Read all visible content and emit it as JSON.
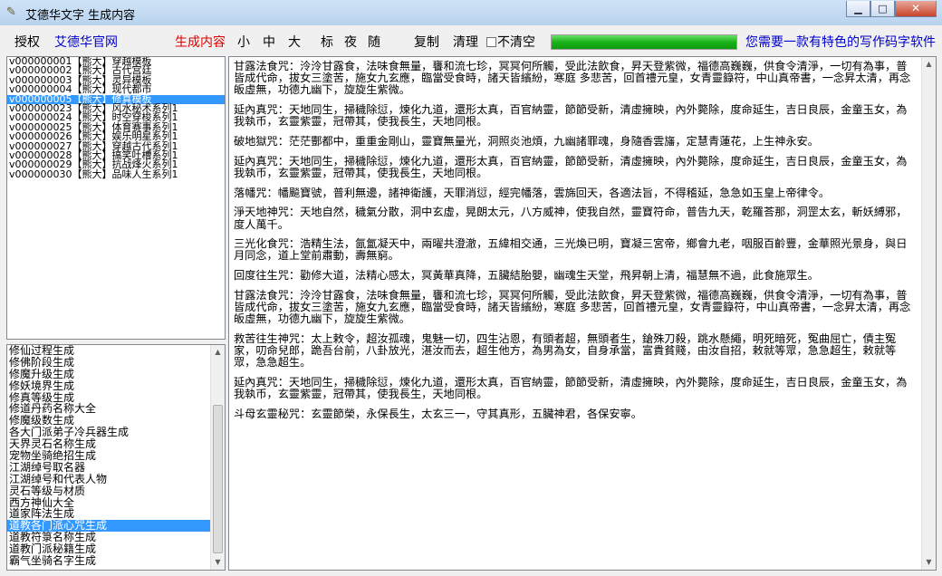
{
  "window": {
    "title": "艾德华文字 生成内容",
    "app_icon": "feather-icon",
    "buttons": {
      "minimize": "▁",
      "maximize": "□",
      "close": "✕"
    }
  },
  "toolbar": {
    "authorize": "授权",
    "official_site": "艾德华官网",
    "generate": "生成内容",
    "size_small": "小",
    "size_medium": "中",
    "size_large": "大",
    "mark": "标",
    "night": "夜",
    "random": "随",
    "copy": "复制",
    "clear": "清理",
    "no_clear_label": "不清空",
    "no_clear_checked": false,
    "progress_percent": 100,
    "slogan": "您需要一款有特色的写作码字软件"
  },
  "templates": {
    "items": [
      "v000000001【熊大】穿越模板",
      "v000000002【熊大】古代宫廷",
      "v000000003【熊大】灵异模板",
      "v000000004【熊大】现代都市",
      "v000000005【熊大】修真模板",
      "v000000023【熊大】风水秘术系列1",
      "v000000024【熊大】时空穿梭系列1",
      "v000000025【熊大】体育赛事系列1",
      "v000000026【熊大】娱乐明星系列1",
      "v000000027【熊大】穿越古代系列1",
      "v000000028【熊大】搞笑吐槽系列1",
      "v000000029【熊大】抗战烽火系列1",
      "v000000030【熊大】品味人生系列1"
    ],
    "selected_index": 4
  },
  "generators": {
    "items": [
      "修仙过程生成",
      "修佛阶段生成",
      "修魔升级生成",
      "修妖境界生成",
      "修真等级生成",
      "修道丹药名称大全",
      "修魔级数生成",
      "各大门派弟子冷兵器生成",
      "天界灵石名称生成",
      "宠物坐骑绝招生成",
      "江湖绰号取名器",
      "江湖绰号和代表人物",
      "灵石等级与材质",
      "西方神仙大全",
      "道家阵法生成",
      "道教各门派心咒生成",
      "道教符箓名称生成",
      "道教门派秘籍生成",
      "霸气坐骑名字生成"
    ],
    "selected_index": 15
  },
  "content": {
    "paragraphs": [
      "甘露法食咒：泠泠甘露食，法味食無量，饔和流七珍，冥冥何所觸，受此法飲食，昇天登紫微，福德高巍巍，供食令清淨，一切有為事，普皆成代命，拔女三塗苦，施女九玄應，臨當受食時，諸天皆繽紛，寒庭 多悲苦，回首禮元皇，女青靈籙符，中山真帝書，一念昇太清，再念皈虛無，功德九幽下，旋旋生紫微。",
      "延內真咒：天地同生，掃穢除愆，煉化九道，還形太真，百官納靈，節節受新，清虛擁映，內外斃除，度命延生，吉日良辰，金童玉女，為我執币，玄靈紫靈，冠帶其，使我長生，天地同根。",
      "破地獄咒：茫茫酆都中，重重金剛山，靈寶無量光，洞照炎池煩，九幽諸罪魂，身隨香雲旛，定慧青蓮花，上生神永安。",
      "延內真咒：天地同生，掃穢除愆，煉化九道，還形太真，百官納靈，節節受新，清虛擁映，內外斃除，度命延生，吉日良辰，金童玉女，為我執币，玄靈紫靈，冠帶其，使我長生，天地同根。",
      "落幡咒：幡飈寶號，普利無邊，諸神衛護，天罪消愆，經完幡落，雲旆回天，各適法旨，不得稽延，急急如玉皇上帝律令。",
      "淨天地神咒：天地自然，穢氣分散，洞中玄虛，晃朗太元，八方威神，使我自然，靈寶符命，普告九天，乾羅荅那，洞罡太玄，斬妖縛邪，度人萬千。",
      "三光化食咒：浩精生法，氤氳凝天中，兩曜共澄澈，五緯相交通，三光煥已明，寶凝三宮帝，鄉會九老，咽服百齡豐，金華照光景身，與日月同念，道上堂前肅動，壽無窮。",
      "回度往生咒：勸修大道，法精心感太，冥黃華真降，五臟結胎嬰，幽魂生天堂，飛昇朝上清，福慧無不過，此食施眾生。",
      "甘露法食咒：泠泠甘露食，法味食無量，饔和流七珍，冥冥何所觸，受此法飲食，昇天登紫微，福德高巍巍，供食令清淨，一切有為事，普皆成代命，拔女三塗苦，施女九玄應，臨當受食時，諸天皆繽紛，寒庭 多悲苦，回首禮元皇，女青靈籙符，中山真帝書，一念昇太清，再念皈虛無，功德九幽下，旋旋生紫微。",
      "救苦往生神咒：太上敕令，超汝孤魂，鬼魅一切，四生沾恩，有頭者超，無頭者生，鎗殊刀殺，跳水懸繩，明死暗死，冤曲屈亡，債主冤家，叨命兒郎，跪吾台前，八卦放光，湛汝而去，超生他方，為男為女，自身承當，富貴貧賤，由汝自招，敕就等眾，急急超生，敕就等眾，急急超生。",
      "延內真咒：天地同生，掃穢除愆，煉化九道，還形太真，百官納靈，節節受新，清虛擁映，內外斃除，度命延生，吉日良辰，金童玉女，為我執币，玄靈紫靈，冠帶其，使我長生，天地同根。",
      "斗母玄靈秘咒：玄靈節榮，永保長生，太玄三一，守其真形，五臟神君，各保安寧。"
    ]
  }
}
